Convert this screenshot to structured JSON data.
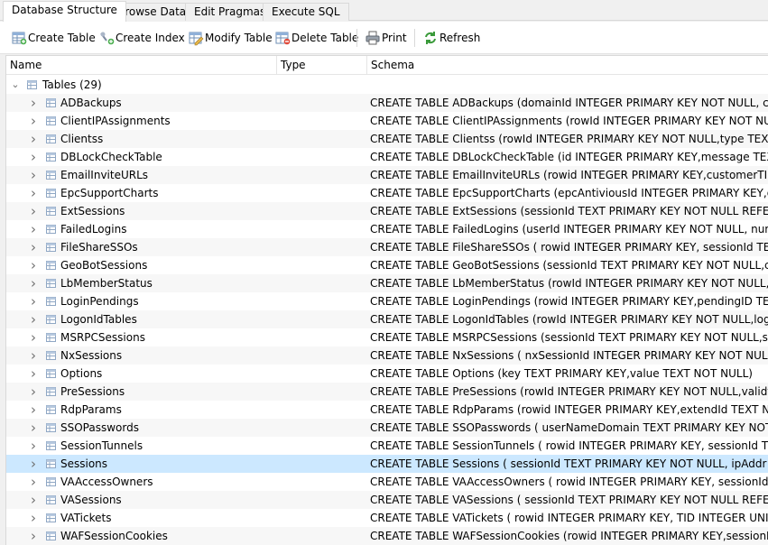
{
  "tabs": [
    {
      "label": "Database Structure",
      "active": true
    },
    {
      "label": "Browse Data",
      "active": false
    },
    {
      "label": "Edit Pragmas",
      "active": false
    },
    {
      "label": "Execute SQL",
      "active": false
    }
  ],
  "toolbar": {
    "create_table": "Create Table",
    "create_index": "Create Index",
    "modify_table": "Modify Table",
    "delete_table": "Delete Table",
    "print": "Print",
    "refresh": "Refresh"
  },
  "columns": {
    "name": "Name",
    "type": "Type",
    "schema": "Schema"
  },
  "group": {
    "label": "Tables (29)"
  },
  "selected_table": "Sessions",
  "tables": [
    {
      "name": "ADBackups",
      "schema": "CREATE TABLE ADBackups (domainId INTEGER PRIMARY KEY NOT NULL, curr"
    },
    {
      "name": "ClientIPAssignments",
      "schema": "CREATE TABLE ClientIPAssignments (rowId INTEGER PRIMARY KEY NOT NUL"
    },
    {
      "name": "Clientss",
      "schema": "CREATE TABLE Clientss (rowId INTEGER PRIMARY KEY NOT NULL,type TEXT,"
    },
    {
      "name": "DBLockCheckTable",
      "schema": "CREATE TABLE DBLockCheckTable (id INTEGER PRIMARY KEY,message TEXT"
    },
    {
      "name": "EmailInviteURLs",
      "schema": "CREATE TABLE EmailInviteURLs (rowid INTEGER PRIMARY KEY,customerTID"
    },
    {
      "name": "EpcSupportCharts",
      "schema": "CREATE TABLE EpcSupportCharts (epcAntiviousId INTEGER PRIMARY KEY,osT"
    },
    {
      "name": "ExtSessions",
      "schema": "CREATE TABLE ExtSessions (sessionId TEXT PRIMARY KEY NOT NULL REFER"
    },
    {
      "name": "FailedLogins",
      "schema": "CREATE TABLE FailedLogins (userId INTEGER PRIMARY KEY NOT NULL, numF"
    },
    {
      "name": "FileShareSSOs",
      "schema": "CREATE TABLE FileShareSSOs ( rowid INTEGER PRIMARY KEY, sessionId TEX"
    },
    {
      "name": "GeoBotSessions",
      "schema": "CREATE TABLE GeoBotSessions (sessionId TEXT PRIMARY KEY NOT NULL,cap"
    },
    {
      "name": "LbMemberStatus",
      "schema": "CREATE TABLE LbMemberStatus (rowId INTEGER PRIMARY KEY NOT NULL,lb"
    },
    {
      "name": "LoginPendings",
      "schema": "CREATE TABLE LoginPendings (rowid INTEGER PRIMARY KEY,pendingID TEXT"
    },
    {
      "name": "LogonIdTables",
      "schema": "CREATE TABLE LogonIdTables (rowId INTEGER PRIMARY KEY NOT NULL,logo"
    },
    {
      "name": "MSRPCSessions",
      "schema": "CREATE TABLE MSRPCSessions (sessionId TEXT PRIMARY KEY NOT NULL,sta"
    },
    {
      "name": "NxSessions",
      "schema": "CREATE TABLE NxSessions ( nxSessionId INTEGER PRIMARY KEY NOT NULL,"
    },
    {
      "name": "Options",
      "schema": "CREATE TABLE Options (key TEXT PRIMARY KEY,value TEXT NOT NULL)"
    },
    {
      "name": "PreSessions",
      "schema": "CREATE TABLE PreSessions (rowId INTEGER PRIMARY KEY NOT NULL,validtir"
    },
    {
      "name": "RdpParams",
      "schema": "CREATE TABLE RdpParams (rowid INTEGER PRIMARY KEY,extendId TEXT NOT"
    },
    {
      "name": "SSOPasswords",
      "schema": "CREATE TABLE SSOPasswords ( userNameDomain TEXT PRIMARY KEY NOT"
    },
    {
      "name": "SessionTunnels",
      "schema": "CREATE TABLE SessionTunnels ( rowid INTEGER PRIMARY KEY, sessionId TE"
    },
    {
      "name": "Sessions",
      "schema": "CREATE TABLE Sessions ( sessionId TEXT PRIMARY KEY NOT NULL, ipAddr T"
    },
    {
      "name": "VAAccessOwners",
      "schema": "CREATE TABLE VAAccessOwners ( rowid INTEGER PRIMARY KEY, sessionId T"
    },
    {
      "name": "VASessions",
      "schema": "CREATE TABLE VASessions ( sessionId TEXT PRIMARY KEY NOT NULL REFER"
    },
    {
      "name": "VATickets",
      "schema": "CREATE TABLE VATickets ( rowid INTEGER PRIMARY KEY, TID INTEGER UNIC"
    },
    {
      "name": "WAFSessionCookies",
      "schema": "CREATE TABLE WAFSessionCookies (rowid INTEGER PRIMARY KEY,sessionId"
    }
  ],
  "icons": {
    "create_table": "table-add-icon",
    "create_index": "index-add-icon",
    "modify_table": "table-edit-icon",
    "delete_table": "table-delete-icon",
    "print": "printer-icon",
    "refresh": "refresh-icon",
    "table": "table-icon",
    "expand": "chevron-right-icon",
    "collapse": "chevron-down-icon"
  },
  "colors": {
    "selection": "#cce8ff",
    "alt_row": "#f7f7f7",
    "table_icon": "#8fa7c4",
    "refresh_green": "#3a9a3a"
  }
}
